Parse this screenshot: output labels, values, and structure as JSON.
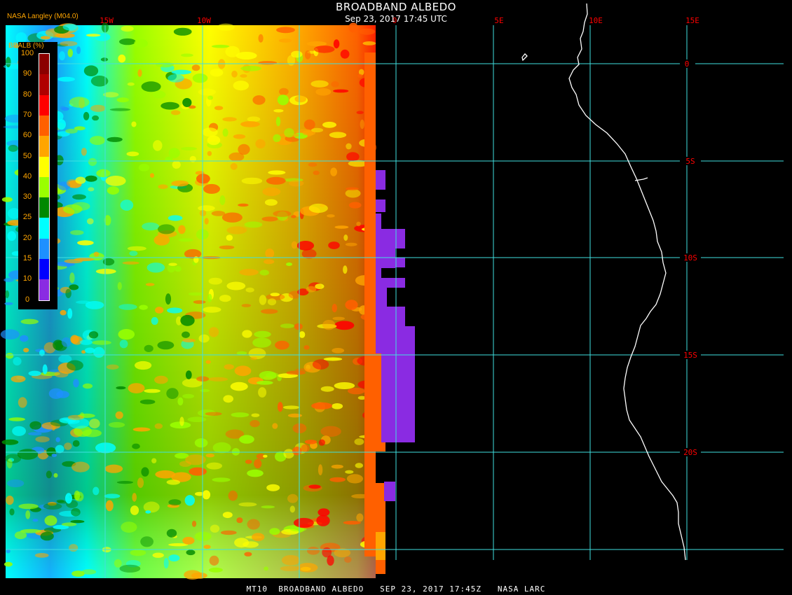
{
  "title": "BROADBAND ALBEDO",
  "subtitle": "Sep 23, 2017 17:45 UTC",
  "agency_label": "NASA Langley (M04.0)",
  "footer": "MT10  BROADBAND ALBEDO   SEP 23, 2017 17:45Z   NASA LARC",
  "legend": {
    "title": "BBALB (%)",
    "ticks": [
      "100",
      "90",
      "80",
      "70",
      "60",
      "50",
      "40",
      "30",
      "25",
      "20",
      "15",
      "10",
      "0"
    ],
    "bins": [
      {
        "range": "90-100",
        "color": "#8b0000"
      },
      {
        "range": "80-90",
        "color": "#b00000"
      },
      {
        "range": "70-80",
        "color": "#ff0000"
      },
      {
        "range": "60-70",
        "color": "#ff6000"
      },
      {
        "range": "50-60",
        "color": "#ffa500"
      },
      {
        "range": "40-50",
        "color": "#ffff00"
      },
      {
        "range": "30-40",
        "color": "#9aff00"
      },
      {
        "range": "25-30",
        "color": "#008800"
      },
      {
        "range": "20-25",
        "color": "#00ffff"
      },
      {
        "range": "15-20",
        "color": "#1e90ff"
      },
      {
        "range": "10-15",
        "color": "#0000ff"
      },
      {
        "range": "0-10",
        "color": "#8a2be2"
      }
    ]
  },
  "longitude_labels": [
    "15W",
    "10W",
    "0",
    "5E",
    "10E",
    "15E"
  ],
  "latitude_labels": [
    "0",
    "5S",
    "10S",
    "15S",
    "20S"
  ],
  "colors": {
    "grid": "#40e0e0",
    "grid_label": "#ff0000",
    "coast": "#ffffff",
    "background": "#000000"
  }
}
